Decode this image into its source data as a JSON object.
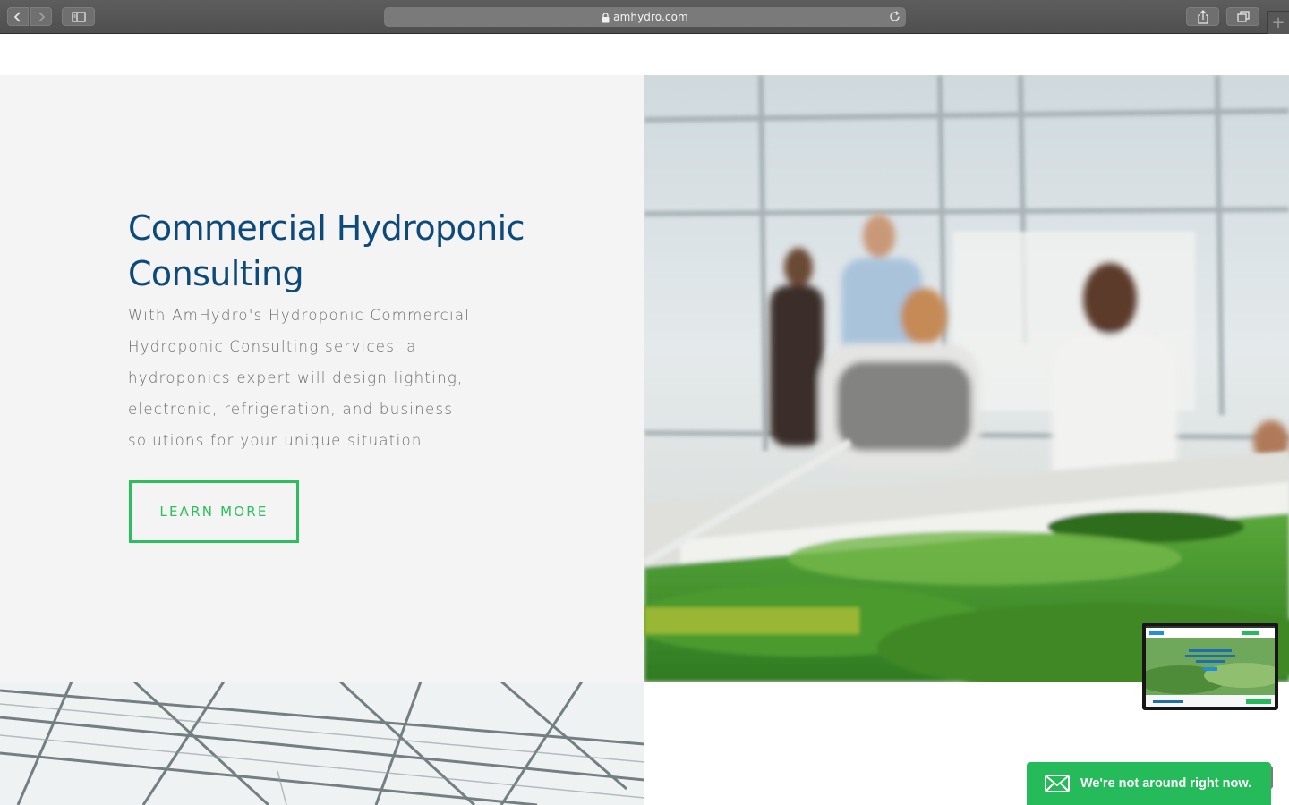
{
  "browser": {
    "url": "amhydro.com",
    "icons": {
      "back": "chevron-left-icon",
      "forward": "chevron-right-icon",
      "sidebar": "sidebar-icon",
      "lock": "lock-icon",
      "reload": "reload-icon",
      "share": "share-icon",
      "tabs": "tabs-icon",
      "new_tab": "plus-icon"
    },
    "new_tab_glyph": "+"
  },
  "feature": {
    "heading": "Commercial Hydroponic Consulting",
    "body": "With AmHydro's Hydroponic Commercial Hydroponic Consulting services, a hydroponics expert will design lighting, electronic, refrigeration, and business solutions for your unique situation.",
    "cta_label": "LEARN MORE"
  },
  "media": {
    "hero_photo": "greenhouse-workers-microgreens-photo",
    "bottom_photo": "greenhouse-roof-structure-photo",
    "preview_thumbnail": "site-preview-thumbnail"
  },
  "chat": {
    "message": "We're not around right now.",
    "icon": "envelope-icon"
  },
  "colors": {
    "heading": "#0d4a7a",
    "body_text": "#6a6a6a",
    "accent_green": "#2dbf5d",
    "chat_green": "#25bb5a",
    "panel_bg": "#f4f4f4"
  }
}
